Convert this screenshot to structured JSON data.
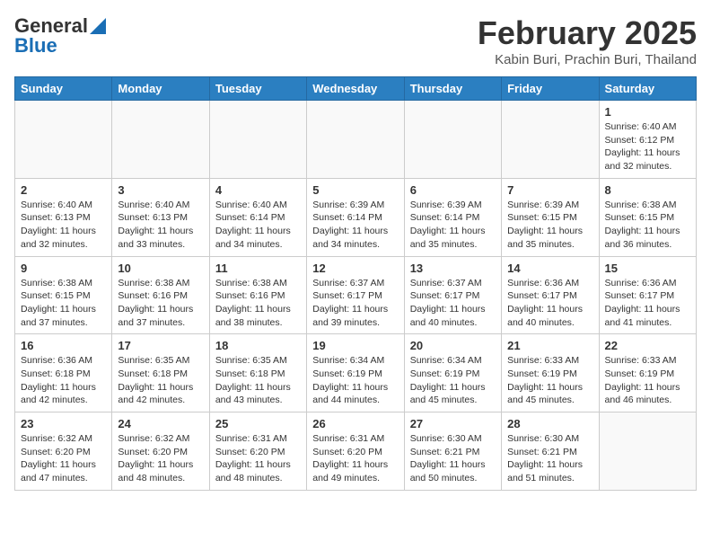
{
  "logo": {
    "line1": "General",
    "line2": "Blue"
  },
  "header": {
    "month": "February 2025",
    "location": "Kabin Buri, Prachin Buri, Thailand"
  },
  "weekdays": [
    "Sunday",
    "Monday",
    "Tuesday",
    "Wednesday",
    "Thursday",
    "Friday",
    "Saturday"
  ],
  "weeks": [
    [
      {
        "day": "",
        "info": ""
      },
      {
        "day": "",
        "info": ""
      },
      {
        "day": "",
        "info": ""
      },
      {
        "day": "",
        "info": ""
      },
      {
        "day": "",
        "info": ""
      },
      {
        "day": "",
        "info": ""
      },
      {
        "day": "1",
        "info": "Sunrise: 6:40 AM\nSunset: 6:12 PM\nDaylight: 11 hours\nand 32 minutes."
      }
    ],
    [
      {
        "day": "2",
        "info": "Sunrise: 6:40 AM\nSunset: 6:13 PM\nDaylight: 11 hours\nand 32 minutes."
      },
      {
        "day": "3",
        "info": "Sunrise: 6:40 AM\nSunset: 6:13 PM\nDaylight: 11 hours\nand 33 minutes."
      },
      {
        "day": "4",
        "info": "Sunrise: 6:40 AM\nSunset: 6:14 PM\nDaylight: 11 hours\nand 34 minutes."
      },
      {
        "day": "5",
        "info": "Sunrise: 6:39 AM\nSunset: 6:14 PM\nDaylight: 11 hours\nand 34 minutes."
      },
      {
        "day": "6",
        "info": "Sunrise: 6:39 AM\nSunset: 6:14 PM\nDaylight: 11 hours\nand 35 minutes."
      },
      {
        "day": "7",
        "info": "Sunrise: 6:39 AM\nSunset: 6:15 PM\nDaylight: 11 hours\nand 35 minutes."
      },
      {
        "day": "8",
        "info": "Sunrise: 6:38 AM\nSunset: 6:15 PM\nDaylight: 11 hours\nand 36 minutes."
      }
    ],
    [
      {
        "day": "9",
        "info": "Sunrise: 6:38 AM\nSunset: 6:15 PM\nDaylight: 11 hours\nand 37 minutes."
      },
      {
        "day": "10",
        "info": "Sunrise: 6:38 AM\nSunset: 6:16 PM\nDaylight: 11 hours\nand 37 minutes."
      },
      {
        "day": "11",
        "info": "Sunrise: 6:38 AM\nSunset: 6:16 PM\nDaylight: 11 hours\nand 38 minutes."
      },
      {
        "day": "12",
        "info": "Sunrise: 6:37 AM\nSunset: 6:17 PM\nDaylight: 11 hours\nand 39 minutes."
      },
      {
        "day": "13",
        "info": "Sunrise: 6:37 AM\nSunset: 6:17 PM\nDaylight: 11 hours\nand 40 minutes."
      },
      {
        "day": "14",
        "info": "Sunrise: 6:36 AM\nSunset: 6:17 PM\nDaylight: 11 hours\nand 40 minutes."
      },
      {
        "day": "15",
        "info": "Sunrise: 6:36 AM\nSunset: 6:17 PM\nDaylight: 11 hours\nand 41 minutes."
      }
    ],
    [
      {
        "day": "16",
        "info": "Sunrise: 6:36 AM\nSunset: 6:18 PM\nDaylight: 11 hours\nand 42 minutes."
      },
      {
        "day": "17",
        "info": "Sunrise: 6:35 AM\nSunset: 6:18 PM\nDaylight: 11 hours\nand 42 minutes."
      },
      {
        "day": "18",
        "info": "Sunrise: 6:35 AM\nSunset: 6:18 PM\nDaylight: 11 hours\nand 43 minutes."
      },
      {
        "day": "19",
        "info": "Sunrise: 6:34 AM\nSunset: 6:19 PM\nDaylight: 11 hours\nand 44 minutes."
      },
      {
        "day": "20",
        "info": "Sunrise: 6:34 AM\nSunset: 6:19 PM\nDaylight: 11 hours\nand 45 minutes."
      },
      {
        "day": "21",
        "info": "Sunrise: 6:33 AM\nSunset: 6:19 PM\nDaylight: 11 hours\nand 45 minutes."
      },
      {
        "day": "22",
        "info": "Sunrise: 6:33 AM\nSunset: 6:19 PM\nDaylight: 11 hours\nand 46 minutes."
      }
    ],
    [
      {
        "day": "23",
        "info": "Sunrise: 6:32 AM\nSunset: 6:20 PM\nDaylight: 11 hours\nand 47 minutes."
      },
      {
        "day": "24",
        "info": "Sunrise: 6:32 AM\nSunset: 6:20 PM\nDaylight: 11 hours\nand 48 minutes."
      },
      {
        "day": "25",
        "info": "Sunrise: 6:31 AM\nSunset: 6:20 PM\nDaylight: 11 hours\nand 48 minutes."
      },
      {
        "day": "26",
        "info": "Sunrise: 6:31 AM\nSunset: 6:20 PM\nDaylight: 11 hours\nand 49 minutes."
      },
      {
        "day": "27",
        "info": "Sunrise: 6:30 AM\nSunset: 6:21 PM\nDaylight: 11 hours\nand 50 minutes."
      },
      {
        "day": "28",
        "info": "Sunrise: 6:30 AM\nSunset: 6:21 PM\nDaylight: 11 hours\nand 51 minutes."
      },
      {
        "day": "",
        "info": ""
      }
    ]
  ]
}
